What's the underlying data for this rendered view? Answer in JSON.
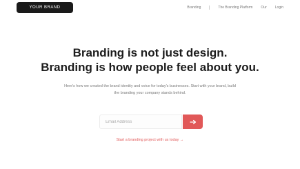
{
  "header": {
    "logo_text": "YOUR BRAND",
    "nav": [
      "Branding",
      "The Branding Platform",
      "Our",
      "Login"
    ]
  },
  "hero": {
    "title_line1": "Branding is not just design.",
    "title_line2": "Branding is how people feel about you.",
    "subtitle": "Here's how we created the brand identity and voice for today's businesses. Start with your brand, build the branding your company stands behind."
  },
  "signup": {
    "placeholder": "Email Address",
    "button_icon": "arrow-right-icon"
  },
  "cta": {
    "link_text": "Start a branding project with us today →"
  },
  "colors": {
    "accent": "#e15858",
    "logo_bg": "#1a1a1a",
    "title": "#1c1c1c",
    "muted": "#777777"
  }
}
